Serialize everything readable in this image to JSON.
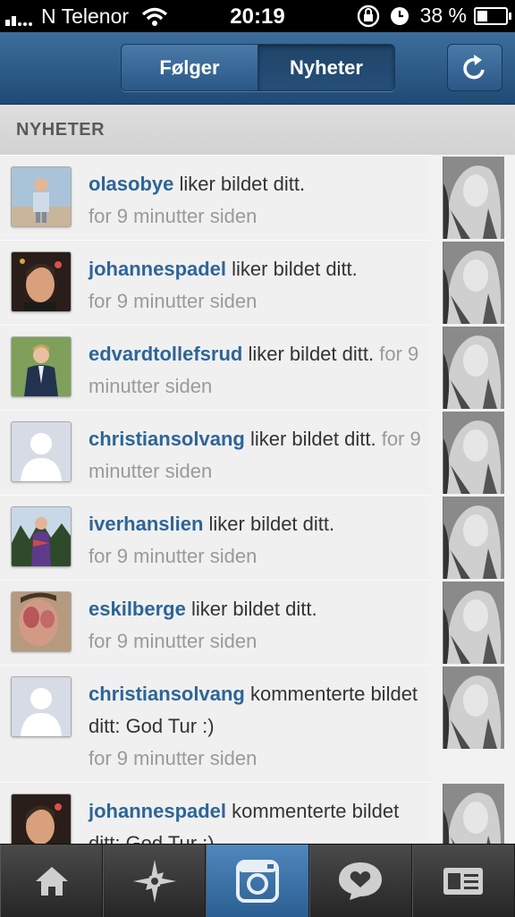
{
  "status_bar": {
    "carrier": "N Telenor",
    "time": "20:19",
    "battery_percent": "38 %",
    "battery_level": 0.38,
    "signal_bars": 2
  },
  "nav": {
    "segments": [
      "Følger",
      "Nyheter"
    ],
    "active_segment": "Nyheter"
  },
  "section": {
    "title": "NYHETER"
  },
  "feed": [
    {
      "user": "olasobye",
      "action": " liker bildet ditt.",
      "time": "for 9 minutter siden"
    },
    {
      "user": "johannespadel",
      "action": " liker bildet ditt.",
      "time": "for 9 minutter siden"
    },
    {
      "user": "edvardtollefsrud",
      "action": " liker bildet ditt.",
      "time": "for 9 minutter siden"
    },
    {
      "user": "christiansolvang",
      "action": " liker bildet ditt.",
      "time": "for 9 minutter siden"
    },
    {
      "user": "iverhanslien",
      "action": " liker bildet ditt.",
      "time": "for 9 minutter siden"
    },
    {
      "user": "eskilberge",
      "action": " liker bildet ditt.",
      "time": "for 9 minutter siden"
    },
    {
      "user": "christiansolvang",
      "action": " kommenterte bildet ditt: God Tur :)",
      "time": "for 9 minutter siden"
    },
    {
      "user": "johannespadel",
      "action": " kommenterte bildet ditt: God Tur :)",
      "time": ""
    }
  ],
  "tabs": [
    "home-icon",
    "explore-icon",
    "camera-icon",
    "news-icon",
    "profile-icon"
  ],
  "active_tab": "camera-icon",
  "colors": {
    "accent": "#2d6597",
    "nav": "#2b5886",
    "tab_active": "#3a72a8"
  }
}
